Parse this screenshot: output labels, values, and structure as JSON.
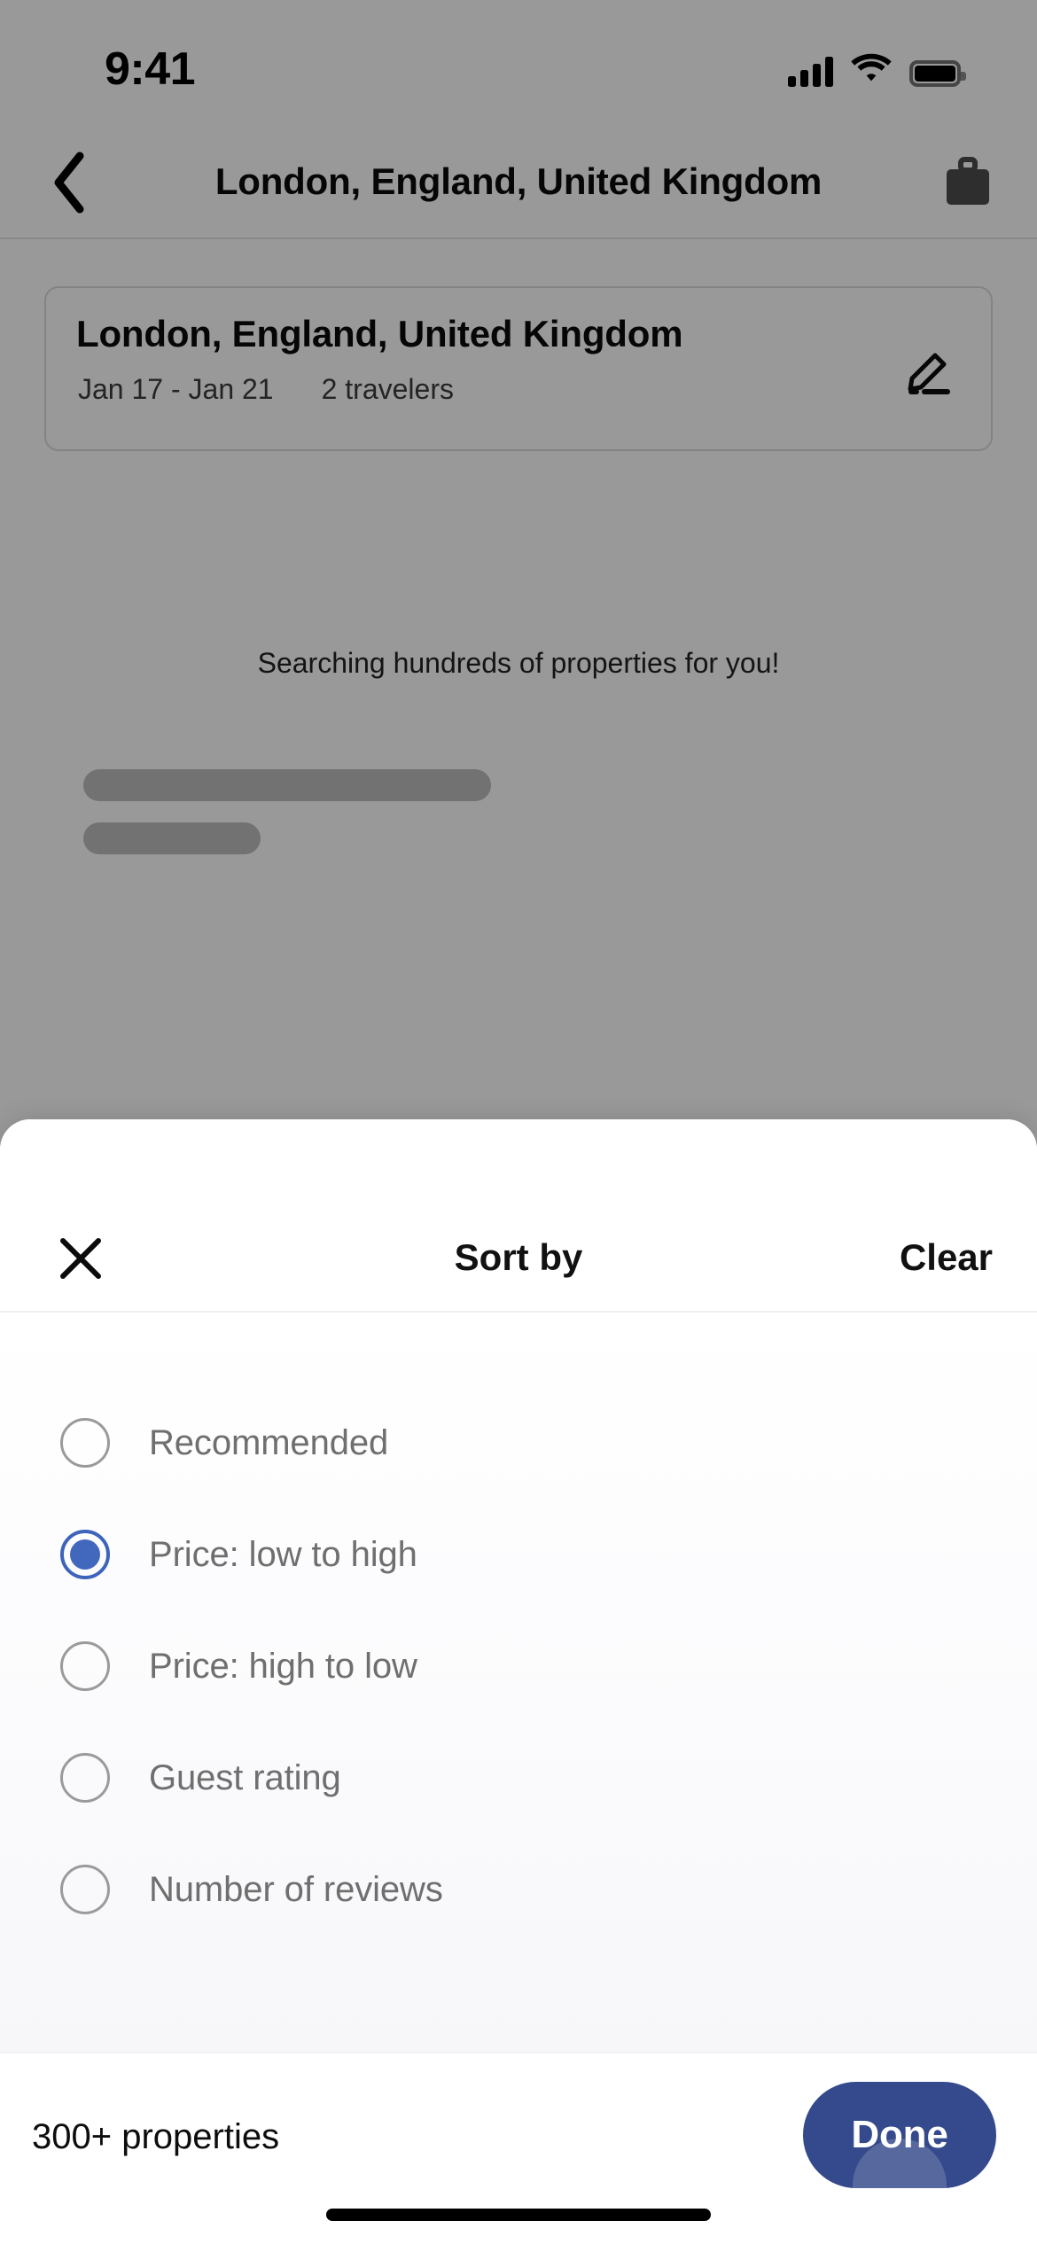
{
  "status_bar": {
    "time": "9:41",
    "icons": [
      "cellular-signal-icon",
      "wifi-icon",
      "battery-icon"
    ]
  },
  "header": {
    "back_icon": "chevron-left-icon",
    "title": "London, England, United Kingdom",
    "trips_icon": "briefcase-icon"
  },
  "search_card": {
    "destination": "London, England, United Kingdom",
    "dates": "Jan 17 - Jan 21",
    "travelers": "2 travelers",
    "edit_icon": "pencil-edit-icon"
  },
  "results": {
    "searching_message": "Searching hundreds of properties for you!",
    "skeleton_placeholder": true
  },
  "sort_sheet": {
    "close_icon": "close-x-icon",
    "title": "Sort by",
    "clear_label": "Clear",
    "selected_option": "Price: low to high",
    "options": [
      {
        "label": "Recommended",
        "selected": false
      },
      {
        "label": "Price: low to high",
        "selected": true
      },
      {
        "label": "Price: high to low",
        "selected": false
      },
      {
        "label": "Guest rating",
        "selected": false
      },
      {
        "label": "Number of reviews",
        "selected": false
      }
    ],
    "footer": {
      "properties_count": "300+ properties",
      "done_label": "Done"
    }
  },
  "colors": {
    "radio_selected": "#4268bd",
    "done_button": "#354a8c",
    "done_text": "#ffffff",
    "option_label": "#6f6f6f",
    "overlay": "rgba(0,0,0,0.40)"
  }
}
